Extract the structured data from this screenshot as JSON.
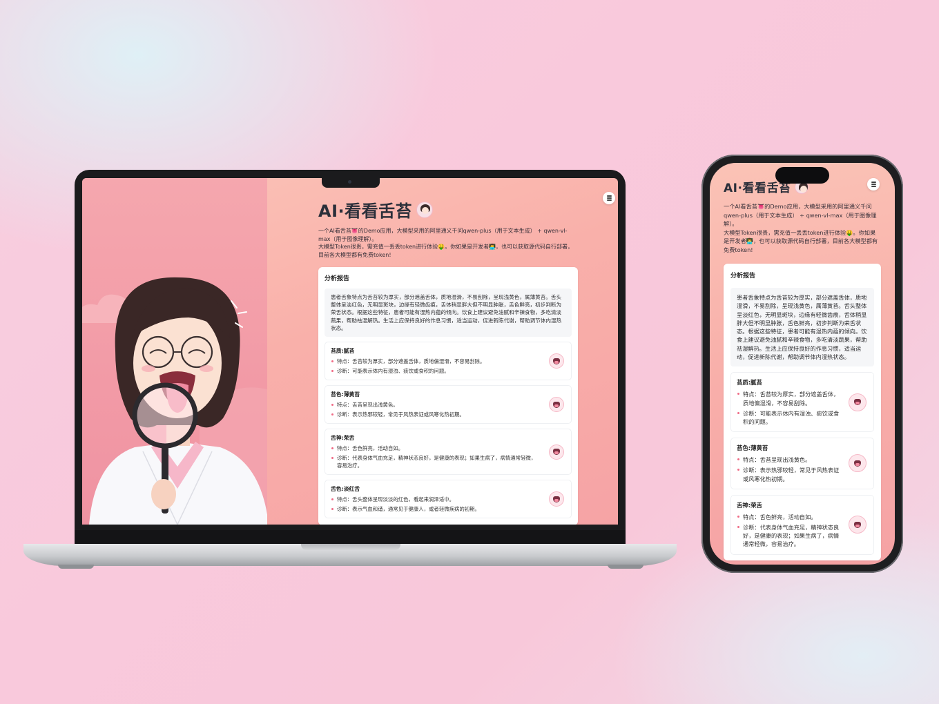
{
  "app": {
    "title": "AI·看看舌苔",
    "intro_line1": "一个AI看舌苔👅的Demo应用，大模型采用的阿里通义千问qwen-plus（用于文本生成） + qwen-vl-max（用于图像理解）。",
    "intro_line2": "大模型Token很贵，需充值一丢丢token进行体验🤑。你如果是开发者👨‍💻，也可以获取源代码自行部署，目前各大模型都有免费token!",
    "menu_icon": "menu-icon",
    "avatar_icon": "doctor-avatar-icon"
  },
  "report": {
    "title": "分析报告",
    "summary": "患者舌象特点为舌苔较为厚实，部分遮盖舌体，质地湿滑，不易刮除，呈现浅黄色，属薄黄苔。舌头整体呈淡红色，无明显斑块，边缘有轻微齿痕，舌体稍显胖大但不明显肿胀，舌色鲜亮，初步判断为荣舌状态。根据这些特征，患者可能有湿热内蕴的倾向。饮食上建议避免油腻和辛辣食物，多吃清淡蔬果，帮助祛湿解热。生活上应保持良好的作息习惯，适当运动，促进新陈代谢，帮助调节体内湿热状态。",
    "items": [
      {
        "title": "苔质:腻苔",
        "feature": "特点：舌苔较为厚实，部分遮盖舌体，质地偏湿滑，不容易刮除。",
        "diagnosis": "诊断：可能表示体内有湿浊、痰饮或食积的问题。"
      },
      {
        "title": "苔色:薄黄苔",
        "feature": "特点：舌苔呈现出浅黄色。",
        "diagnosis": "诊断：表示热邪较轻，常见于风热表证或风寒化热初期。"
      },
      {
        "title": "舌神:荣舌",
        "feature": "特点：舌色鲜亮，活动自如。",
        "diagnosis": "诊断：代表身体气血充足，精神状态良好，是健康的表现；如果生病了，病情通常轻微，容易治疗。"
      },
      {
        "title": "舌色:淡红舌",
        "feature": "特点：舌头整体呈现淡淡的红色，看起来润泽适中。",
        "diagnosis": "诊断：表示气血和谐，通常见于健康人，或者轻微疾病的初期。"
      }
    ]
  },
  "colors": {
    "accent": "#f06b86",
    "screen_bg": "#f9b0aa",
    "card_bg": "#ffffff",
    "title_text": "#2b2f3a"
  }
}
